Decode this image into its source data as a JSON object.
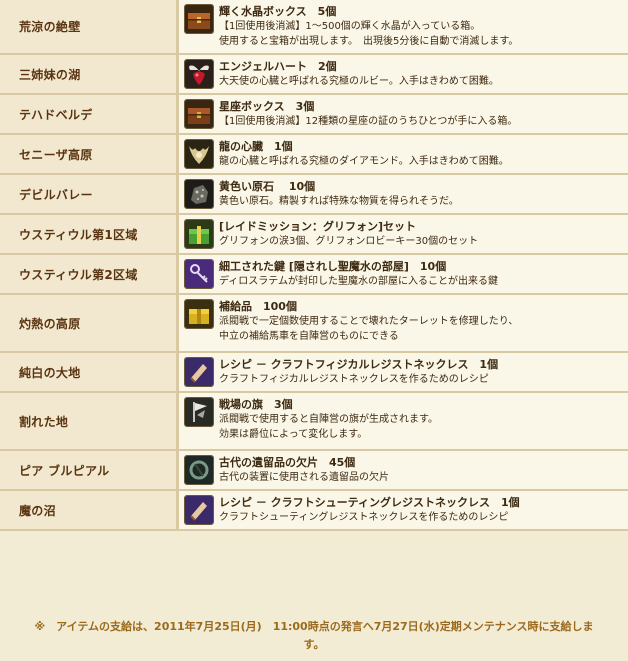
{
  "rows": [
    {
      "location": "荒涼の絶壁",
      "item_name": "輝く水晶ボックス　5個",
      "desc": [
        "【1回使用後消滅】1～500個の輝く水晶が入っている箱。",
        "使用すると宝箱が出現します。　出現後5分後に自動で消滅します。"
      ],
      "icon": "treasure-chest-icon"
    },
    {
      "location": "三姉妹の湖",
      "item_name": "エンジェルハート　2個",
      "desc": [
        "大天使の心臓と呼ばれる究極のルビー。入手はきわめて困難。"
      ],
      "icon": "angel-heart-icon"
    },
    {
      "location": "テハドベルデ",
      "item_name": "星座ボックス　3個",
      "desc": [
        "【1回使用後消滅】12種類の星座の証のうちひとつが手に入る箱。"
      ],
      "icon": "constellation-box-icon"
    },
    {
      "location": "セニーザ高原",
      "item_name": "龍の心臓　1個",
      "desc": [
        "龍の心臓と呼ばれる究極のダイアモンド。入手はきわめて困難。"
      ],
      "icon": "dragon-heart-icon"
    },
    {
      "location": "デビルバレー",
      "item_name": "黄色い原石　 10個",
      "desc": [
        "黄色い原石。精製すれば特殊な物質を得られそうだ。"
      ],
      "icon": "yellow-ore-icon"
    },
    {
      "location": "ウスティウル第1区域",
      "item_name": "[レイドミッション：グリフォン]セット",
      "desc": [
        "グリフォンの涙3個、グリフォンロビーキー30個のセット"
      ],
      "icon": "gift-box-icon"
    },
    {
      "location": "ウスティウル第2区域",
      "item_name": "細工された鍵 [隠されし聖魔水の部屋]　10個",
      "desc": [
        "ディロスラテムが封印した聖魔水の部屋に入ることが出来る鍵"
      ],
      "icon": "key-icon"
    },
    {
      "location": "灼熱の高原",
      "item_name": "補給品　100個",
      "desc": [
        "派閥戦で一定個数使用することで壊れたターレットを修理したり、",
        "中立の補給馬車を自陣営のものにできる"
      ],
      "icon": "supply-box-icon"
    },
    {
      "location": "純白の大地",
      "item_name": "レシピ － クラフトフィジカルレジストネックレス　1個",
      "desc": [
        "クラフトフィジカルレジストネックレスを作るためのレシピ"
      ],
      "icon": "recipe-scroll-icon"
    },
    {
      "location": "割れた地",
      "item_name": "戦場の旗　3個",
      "desc": [
        "派閥戦で使用すると自陣営の旗が生成されます。",
        "効果は爵位によって変化します。"
      ],
      "icon": "battle-flag-icon"
    },
    {
      "location": "ピア ブルピアル",
      "item_name": "古代の遺留品の欠片　45個",
      "desc": [
        "古代の装置に使用される遺留品の欠片"
      ],
      "icon": "relic-fragment-icon"
    },
    {
      "location": "魔の沼",
      "item_name": "レシピ － クラフトシューティングレジストネックレス　1個",
      "desc": [
        "クラフトシューティングレジストネックレスを作るためのレシピ"
      ],
      "icon": "recipe-scroll-icon"
    }
  ],
  "footnote": {
    "line1": "※　アイテムの支給は、2011年7月25日(月)　11:00時点の発言へ7月27日(水)定期メンテナンス時に支給しま",
    "line2": "す。"
  },
  "colors": {
    "border": "#d9c9a2",
    "location_bg": "#f1e8cf",
    "item_bg": "#fbf7e8",
    "location_text": "#5a3411",
    "footnote_text": "#9b6a1d"
  }
}
